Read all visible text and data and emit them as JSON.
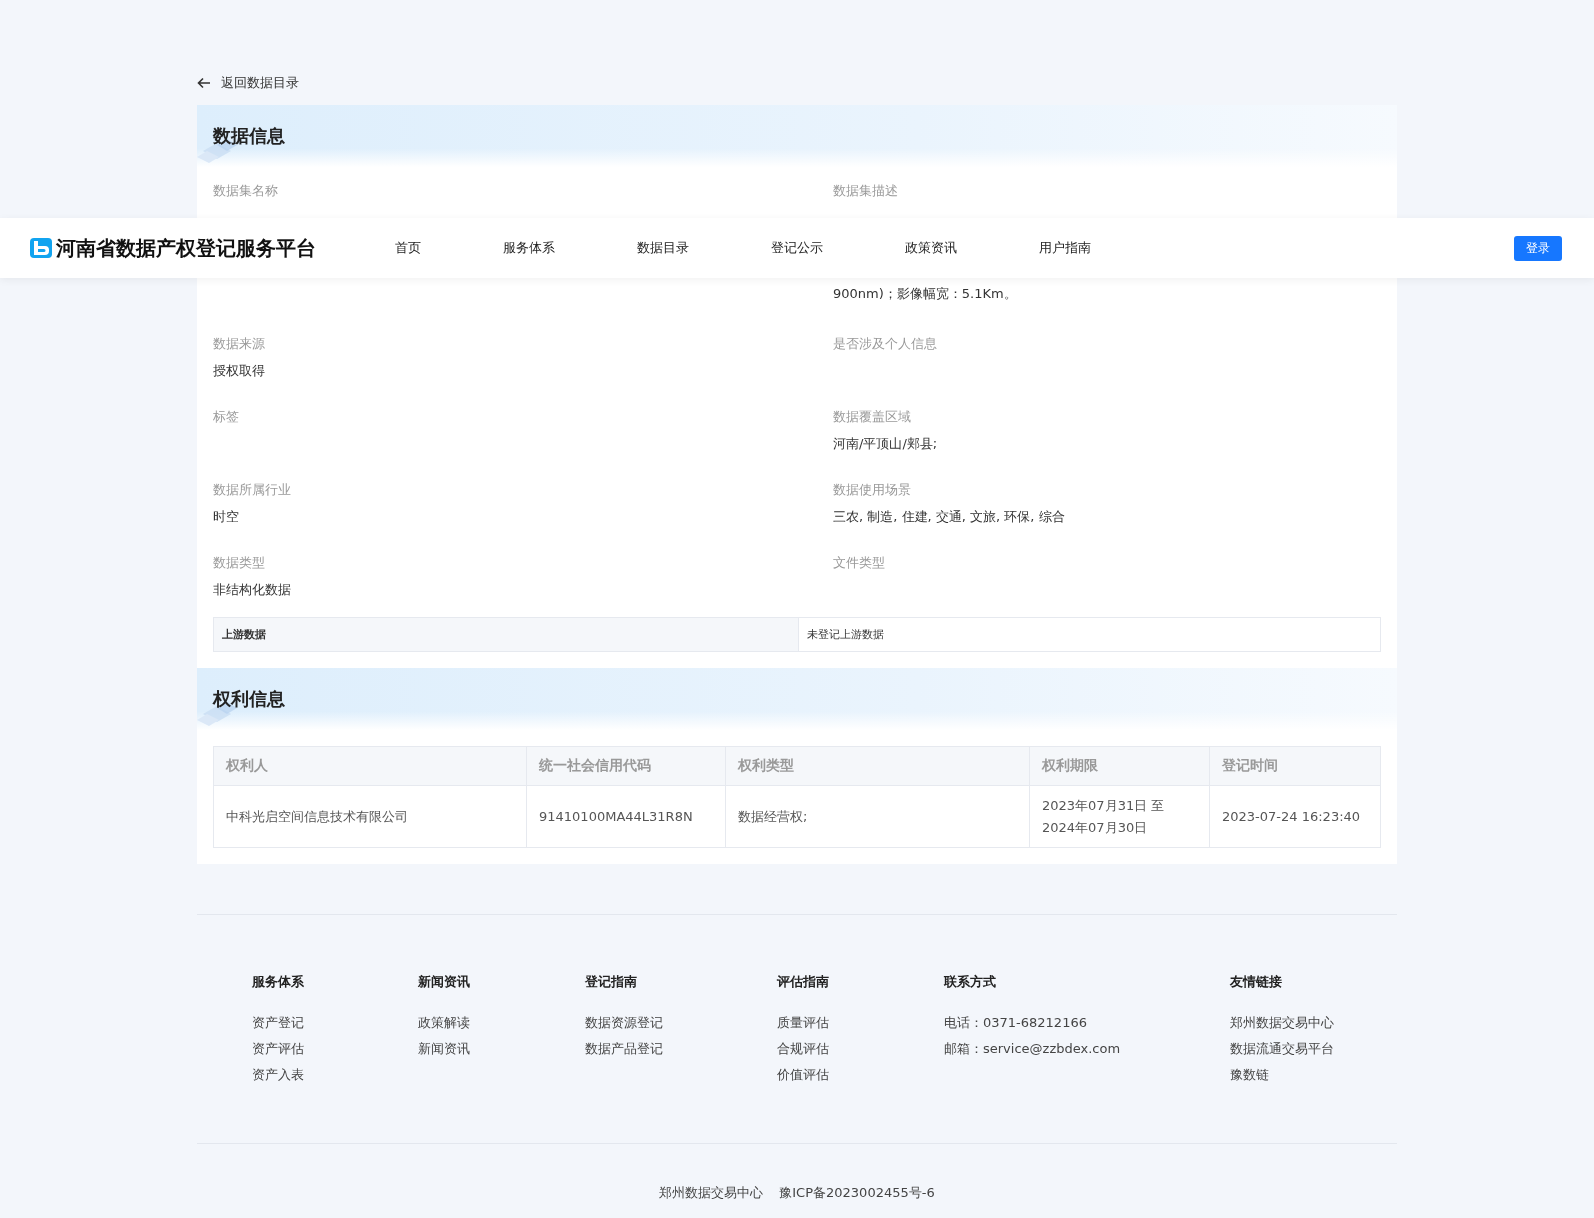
{
  "back_link": "返回数据目录",
  "header": {
    "title": "河南省数据产权登记服务平台",
    "nav": [
      {
        "label": "首页",
        "selected": false
      },
      {
        "label": "服务体系",
        "selected": false
      },
      {
        "label": "数据目录",
        "selected": false
      },
      {
        "label": "登记公示",
        "selected": false
      },
      {
        "label": "政策资讯",
        "selected": false
      },
      {
        "label": "用户指南",
        "selected": false
      }
    ],
    "login": "登录"
  },
  "data_info": {
    "title": "数据信息",
    "name": {
      "label": "数据集名称"
    },
    "description": {
      "label": "数据集描述",
      "visible_line": "900nm)；影像幅宽：5.1Km。"
    },
    "fields": [
      {
        "label": "数据来源",
        "value": "授权取得"
      },
      {
        "label": "是否涉及个人信息"
      },
      {
        "label": "标签"
      },
      {
        "label": "数据覆盖区域",
        "value": "河南/平顶山/郏县;"
      },
      {
        "label": "数据所属行业",
        "value": "时空"
      },
      {
        "label": "数据使用场景",
        "value": "三农, 制造, 住建, 交通, 文旅, 环保, 综合"
      },
      {
        "label": "数据类型",
        "value": "非结构化数据"
      },
      {
        "label": "文件类型"
      }
    ],
    "upstream": {
      "label": "上游数据",
      "value": "未登记上游数据"
    }
  },
  "rights_info": {
    "title": "权利信息",
    "columns": [
      "权利人",
      "统一社会信用代码",
      "权利类型",
      "权利期限",
      "登记时间"
    ],
    "rows": [
      [
        "中科光启空间信息技术有限公司",
        "91410100MA44L31R8N",
        "数据经营权;",
        "2023年07月31日 至 2024年07月30日",
        "2023-07-24 16:23:40"
      ]
    ]
  },
  "footer": {
    "columns": [
      {
        "heading": "服务体系",
        "items": [
          "资产登记",
          "资产评估",
          "资产入表"
        ]
      },
      {
        "heading": "新闻资讯",
        "items": [
          "政策解读",
          "新闻资讯"
        ]
      },
      {
        "heading": "登记指南",
        "items": [
          "数据资源登记",
          "数据产品登记"
        ]
      },
      {
        "heading": "评估指南",
        "items": [
          "质量评估",
          "合规评估",
          "价值评估"
        ]
      },
      {
        "heading": "联系方式",
        "items": [
          "电话：0371-68212166",
          "邮箱：service@zzbdex.com"
        ]
      },
      {
        "heading": "友情链接",
        "items": [
          "郑州数据交易中心",
          "数据流通交易平台",
          "豫数链"
        ]
      }
    ],
    "bottom": [
      "郑州数据交易中心",
      "豫ICP备2023002455号-6"
    ]
  }
}
